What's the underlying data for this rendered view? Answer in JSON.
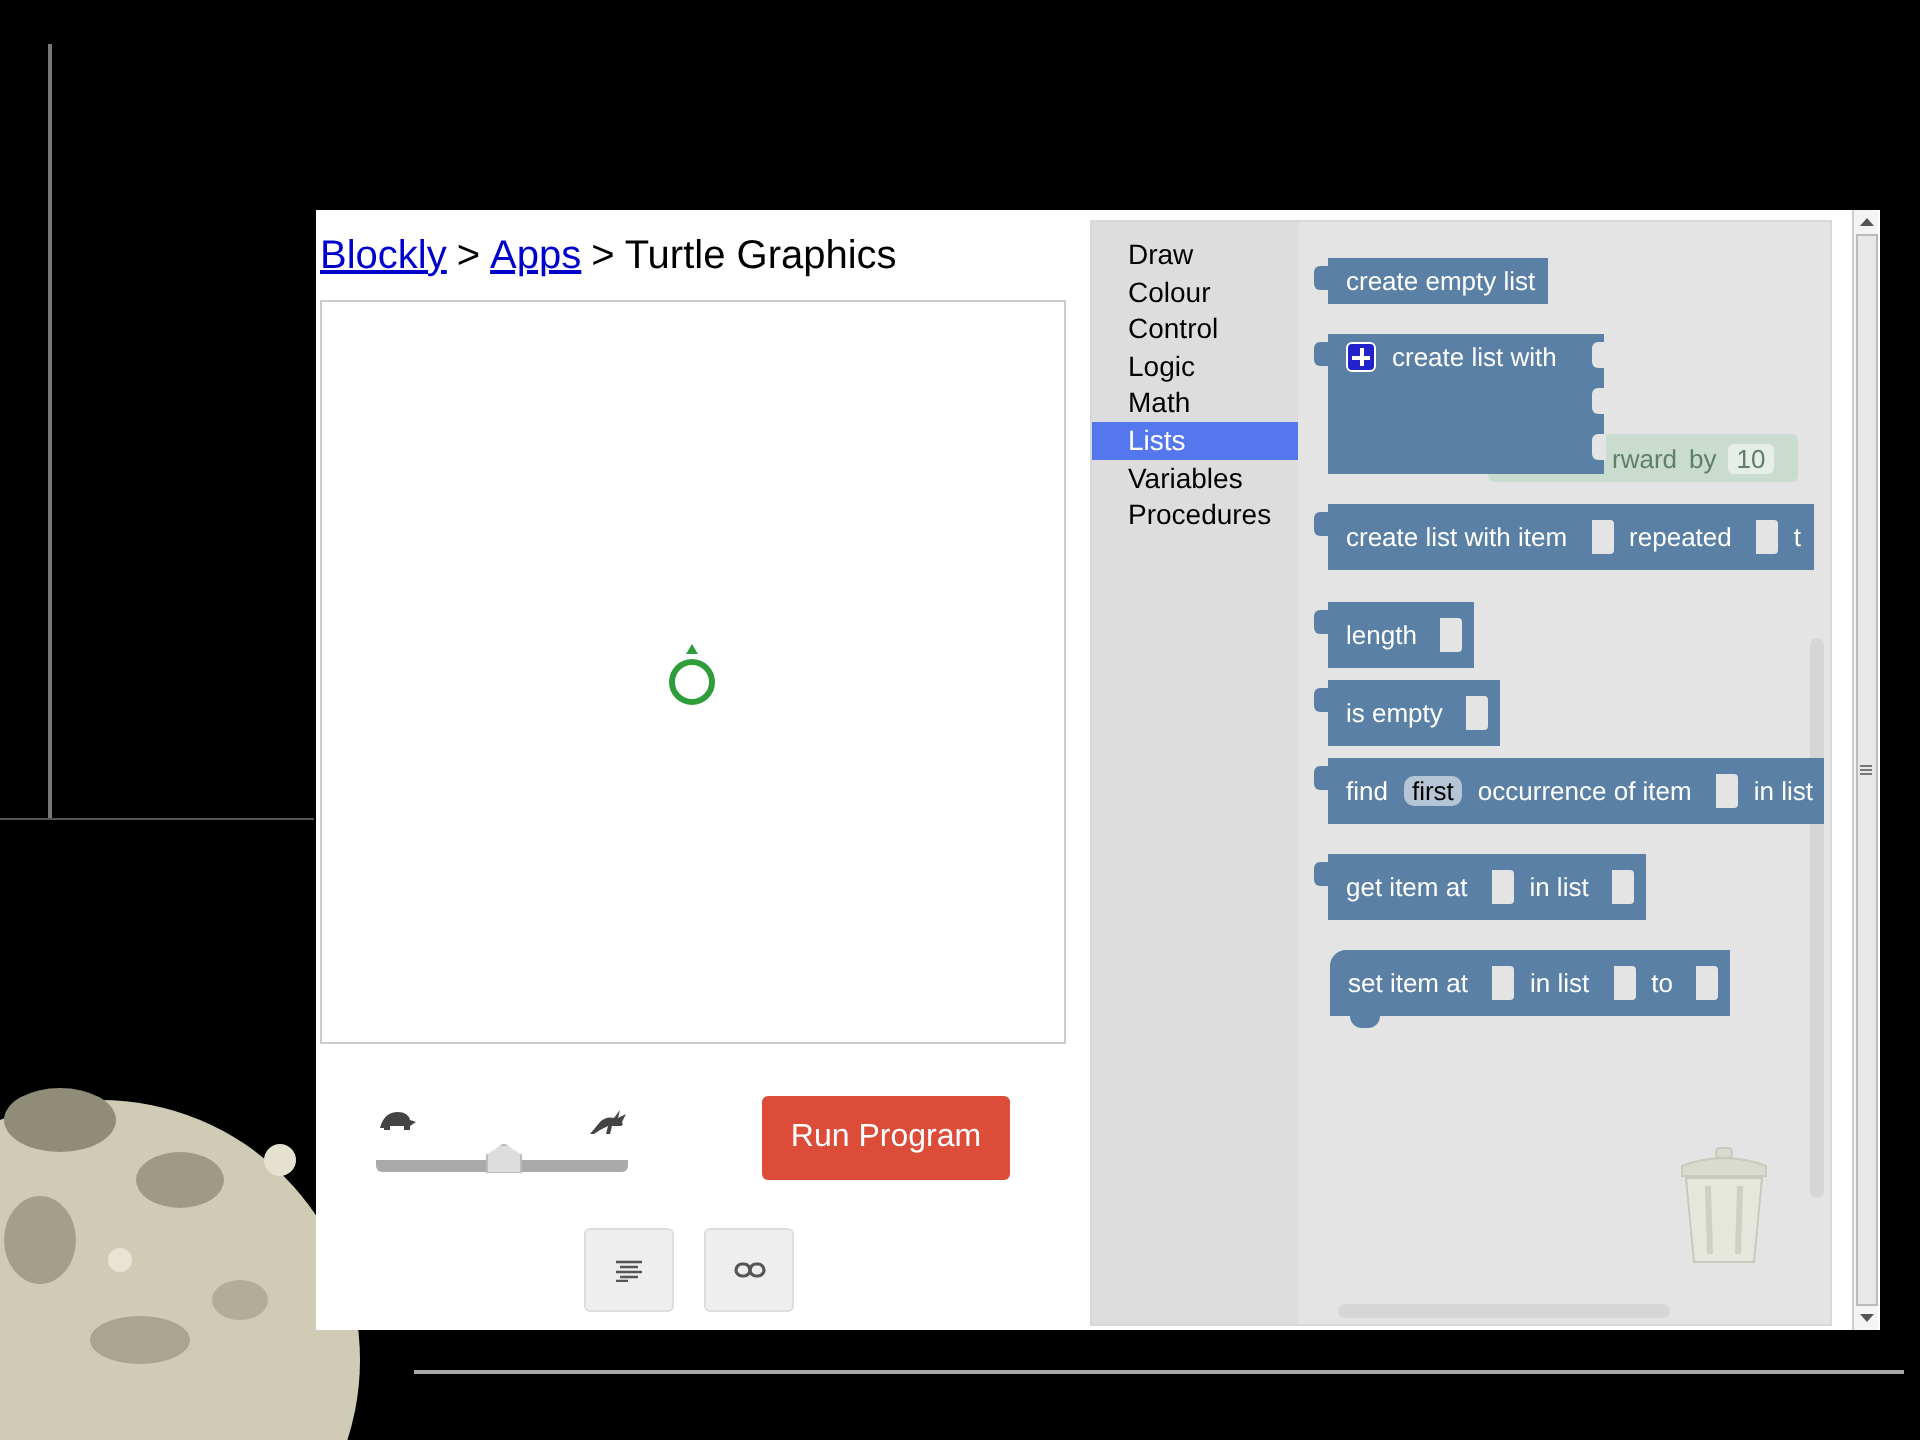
{
  "breadcrumb": [
    {
      "kind": "link",
      "text": "Blockly"
    },
    {
      "kind": "separator",
      "text": ">"
    },
    {
      "kind": "link",
      "text": "Apps"
    },
    {
      "kind": "separator",
      "text": ">"
    },
    {
      "kind": "current",
      "text": "Turtle Graphics"
    }
  ],
  "speed_slider": {
    "level": 0.5
  },
  "run_button": {
    "label": "Run Program"
  },
  "toolbox": {
    "categories": [
      {
        "label": "Draw",
        "selected": false
      },
      {
        "label": "Colour",
        "selected": false
      },
      {
        "label": "Control",
        "selected": false
      },
      {
        "label": "Logic",
        "selected": false
      },
      {
        "label": "Math",
        "selected": false
      },
      {
        "label": "Lists",
        "selected": true
      },
      {
        "label": "Variables",
        "selected": false
      },
      {
        "label": "Procedures",
        "selected": false
      }
    ]
  },
  "ghost_block": {
    "parts": [
      "rward",
      "by",
      "10"
    ]
  },
  "flyout_blocks": [
    {
      "kind": "value",
      "parts": [
        {
          "kind": "text",
          "text": "create empty list"
        }
      ]
    },
    {
      "kind": "value_multi",
      "parts": [
        {
          "kind": "plus"
        },
        {
          "kind": "text",
          "text": "create list with"
        }
      ]
    },
    {
      "kind": "value",
      "parts": [
        {
          "kind": "text",
          "text": "create list with item"
        },
        {
          "kind": "input"
        },
        {
          "kind": "text",
          "text": "repeated"
        },
        {
          "kind": "input"
        },
        {
          "kind": "text",
          "text": "t"
        }
      ]
    },
    {
      "kind": "value",
      "parts": [
        {
          "kind": "text",
          "text": "length"
        },
        {
          "kind": "input"
        }
      ]
    },
    {
      "kind": "value",
      "parts": [
        {
          "kind": "text",
          "text": "is empty"
        },
        {
          "kind": "input"
        }
      ]
    },
    {
      "kind": "value",
      "parts": [
        {
          "kind": "text",
          "text": "find"
        },
        {
          "kind": "dropdown",
          "text": "first"
        },
        {
          "kind": "text",
          "text": "occurrence of item"
        },
        {
          "kind": "input"
        },
        {
          "kind": "text",
          "text": "in list"
        }
      ]
    },
    {
      "kind": "value",
      "parts": [
        {
          "kind": "text",
          "text": "get item at"
        },
        {
          "kind": "input"
        },
        {
          "kind": "text",
          "text": "in list"
        },
        {
          "kind": "input"
        }
      ]
    },
    {
      "kind": "statement",
      "parts": [
        {
          "kind": "text",
          "text": "set item at"
        },
        {
          "kind": "input"
        },
        {
          "kind": "text",
          "text": "in list"
        },
        {
          "kind": "input"
        },
        {
          "kind": "text",
          "text": "to"
        },
        {
          "kind": "input"
        }
      ]
    }
  ]
}
